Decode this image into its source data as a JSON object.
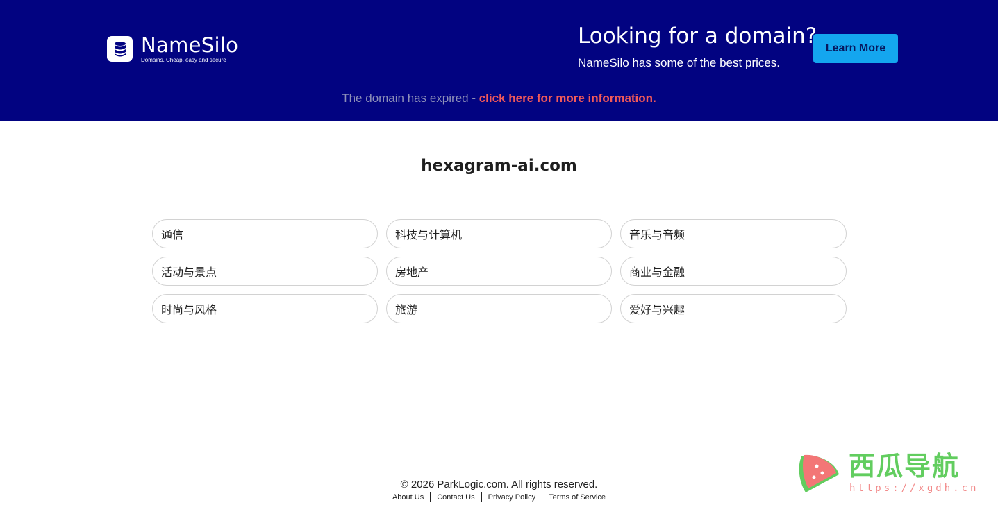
{
  "header": {
    "logo_name": "NameSilo",
    "logo_tagline": "Domains. Cheap, easy and secure",
    "promo_title": "Looking for a domain?",
    "promo_subtitle": "NameSilo has some of the best prices.",
    "learn_more_label": "Learn More",
    "expired_text": "The domain has expired - ",
    "expired_link": "click here for more information."
  },
  "main": {
    "domain": "hexagram-ai.com",
    "links": [
      "通信",
      "科技与计算机",
      "音乐与音频",
      "活动与景点",
      "房地产",
      "商业与金融",
      "时尚与风格",
      "旅游",
      "爱好与兴趣"
    ]
  },
  "footer": {
    "copyright": "© 2026 ParkLogic.com. All rights reserved.",
    "links": [
      "About Us",
      "Contact Us",
      "Privacy Policy",
      "Terms of Service"
    ]
  },
  "watermark": {
    "title": "西瓜导航",
    "url": "https://xgdh.cn"
  },
  "colors": {
    "banner": "#020381",
    "button": "#14a6ef",
    "expired_link": "#f25a5a",
    "watermark_green": "#62cd5f"
  },
  "icons": [
    "database-icon",
    "watermelon-logo-icon"
  ]
}
